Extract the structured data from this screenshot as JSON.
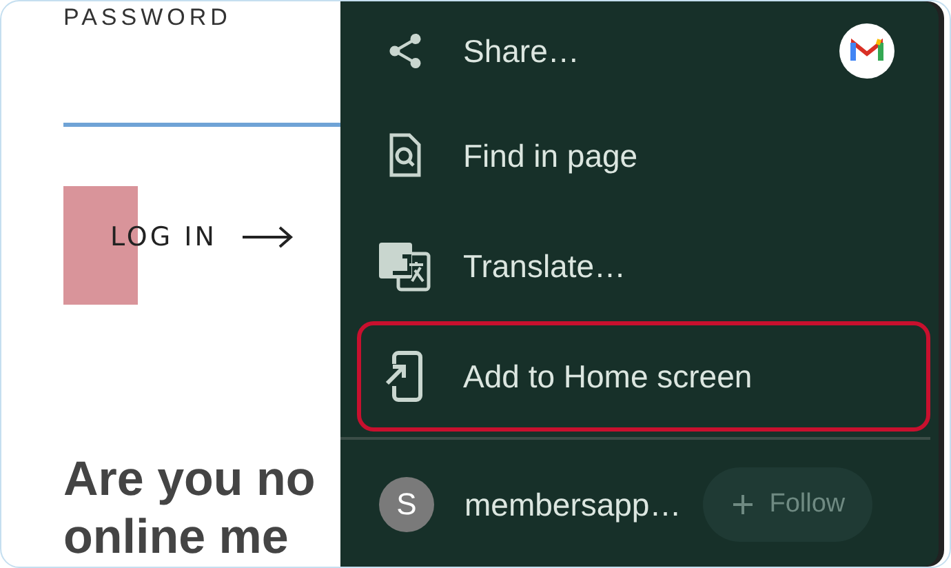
{
  "page": {
    "password_label": "PASSWORD",
    "login_button": "LOG IN",
    "heading_lines": [
      "Are you no",
      "online me"
    ]
  },
  "menu": {
    "items": [
      {
        "label": "Share…",
        "kind": "share",
        "highlighted": false,
        "shortcut": true
      },
      {
        "label": "Find in page",
        "kind": "find",
        "highlighted": false,
        "shortcut": false
      },
      {
        "label": "Translate…",
        "kind": "translate",
        "highlighted": false,
        "shortcut": false
      },
      {
        "label": "Add to Home screen",
        "kind": "add-home",
        "highlighted": true,
        "shortcut": false
      }
    ],
    "account": {
      "initial": "S",
      "name": "membersapp…",
      "follow_button": "Follow",
      "follow_enabled": false
    }
  }
}
